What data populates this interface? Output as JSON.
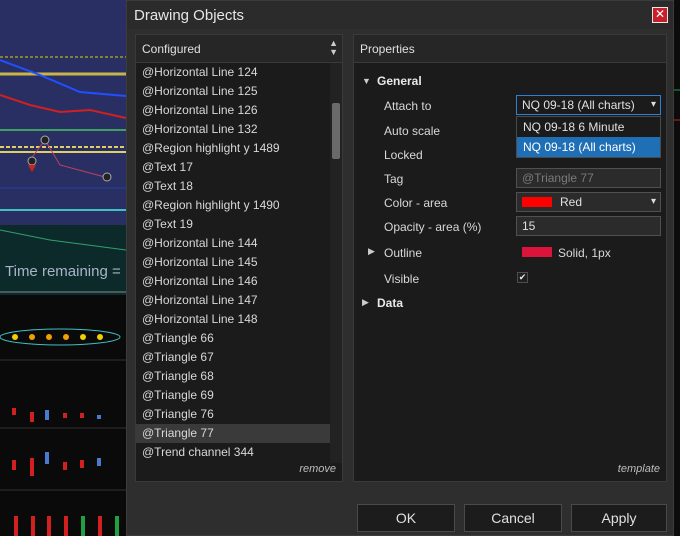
{
  "background": {
    "time_remaining": "Time remaining ="
  },
  "dialog": {
    "title": "Drawing Objects",
    "close_glyph": "✕",
    "configured": {
      "header": "Configured",
      "items": [
        "@Horizontal Line 124",
        "@Horizontal Line 125",
        "@Horizontal Line 126",
        "@Horizontal Line 132",
        "@Region highlight y 1489",
        "@Text 17",
        "@Text 18",
        "@Region highlight y 1490",
        "@Text 19",
        "@Horizontal Line 144",
        "@Horizontal Line 145",
        "@Horizontal Line 146",
        "@Horizontal Line 147",
        "@Horizontal Line 148",
        "@Triangle 66",
        "@Triangle 67",
        "@Triangle 68",
        "@Triangle 69",
        "@Triangle 76",
        "@Triangle 77",
        "@Trend channel 344"
      ],
      "selected_item": "@Triangle 77",
      "remove_label": "remove"
    },
    "properties": {
      "header": "Properties",
      "general_label": "General",
      "attach_to_label": "Attach to",
      "attach_to_value": "NQ 09-18 (All charts)",
      "attach_to_options": [
        "NQ 09-18 6 Minute",
        "NQ 09-18 (All charts)"
      ],
      "auto_scale_label": "Auto scale",
      "locked_label": "Locked",
      "tag_label": "Tag",
      "tag_placeholder": "@Triangle 77",
      "color_area_label": "Color - area",
      "color_area_value": "Red",
      "color_area_hex": "#ff0000",
      "opacity_label": "Opacity - area (%)",
      "opacity_value": "15",
      "outline_label": "Outline",
      "outline_value": "Solid, 1px",
      "outline_hex": "#dc143c",
      "visible_label": "Visible",
      "visible_checked": true,
      "data_label": "Data",
      "template_label": "template"
    },
    "buttons": {
      "ok": "OK",
      "cancel": "Cancel",
      "apply": "Apply"
    }
  }
}
